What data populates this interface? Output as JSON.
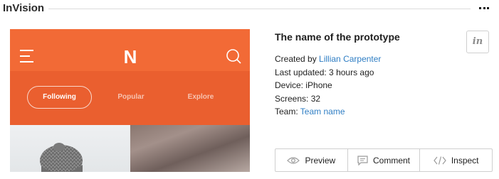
{
  "card": {
    "title": "InVision"
  },
  "preview": {
    "logo": "N",
    "tabs": [
      "Following",
      "Popular",
      "Explore"
    ],
    "accent_color": "#f26a36"
  },
  "prototype": {
    "name": "The name of the prototype",
    "created_by_label": "Created by ",
    "created_by_name": "Lillian Carpenter",
    "last_updated": "Last updated: 3 hours ago",
    "device": "Device: iPhone",
    "screens": "Screens: 32",
    "team_label": "Team: ",
    "team_name": "Team name",
    "link_color": "#2f7ec4"
  },
  "badge": {
    "label": "in"
  },
  "actions": {
    "preview": "Preview",
    "comment": "Comment",
    "inspect": "Inspect"
  }
}
